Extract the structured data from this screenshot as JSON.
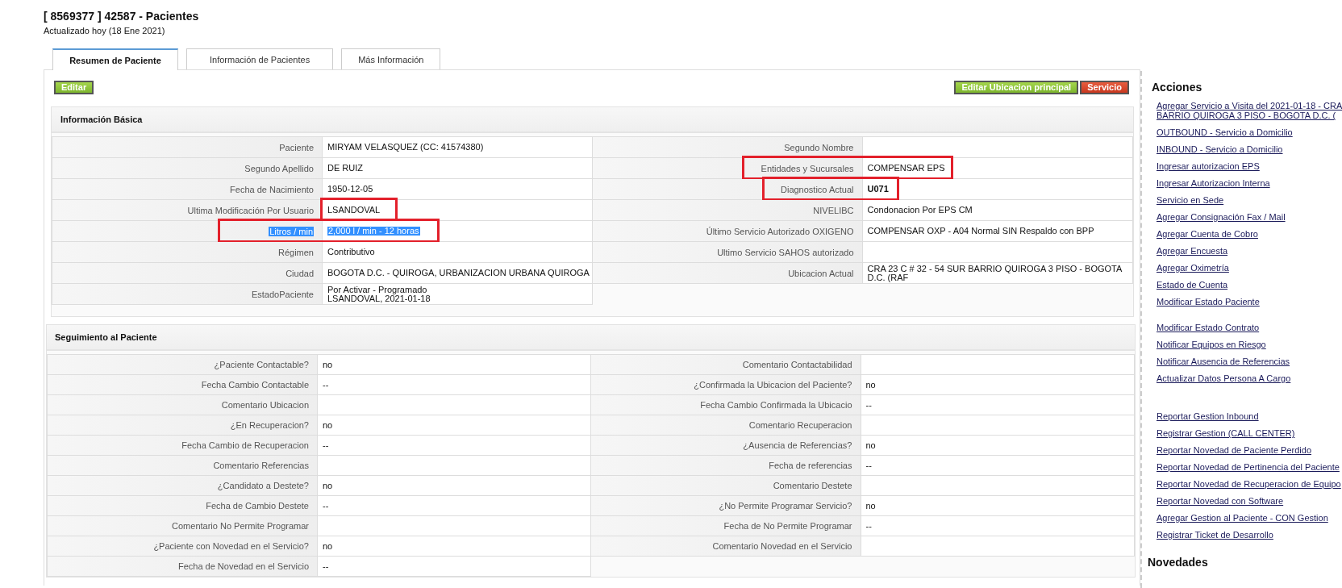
{
  "header": {
    "title": "[ 8569377 ] 42587 - Pacientes",
    "updated": "Actualizado hoy (18 Ene 2021)"
  },
  "tabs": [
    {
      "label": "Resumen de Paciente",
      "selected": true
    },
    {
      "label": "Información de Pacientes",
      "selected": false
    },
    {
      "label": "Más Información",
      "selected": false
    }
  ],
  "toolbar": {
    "left_buttons": [
      {
        "label": "Editar",
        "kind": "green"
      }
    ],
    "right_buttons": [
      {
        "label": "Editar Ubicacion principal",
        "kind": "green"
      },
      {
        "label": "Servicio",
        "kind": "red"
      }
    ]
  },
  "basic_info": {
    "title": "Información Básica",
    "left": [
      {
        "label": "Paciente",
        "value": "MIRYAM VELASQUEZ (CC: 41574380)"
      },
      {
        "label": "Segundo Apellido",
        "value": "DE RUIZ"
      },
      {
        "label": "Fecha de Nacimiento",
        "value": "1950-12-05"
      },
      {
        "label": "Ultima Modificación Por Usuario",
        "value": "LSANDOVAL",
        "annotated": true,
        "annotation_covers_label": false
      },
      {
        "label": "Litros / min",
        "value": "2,000 l / min - 12 horas",
        "annotated": true,
        "annotation_covers_label": true,
        "text_selected": true
      },
      {
        "label": "Régimen",
        "value": "Contributivo"
      },
      {
        "label": "Ciudad",
        "value": "BOGOTA D.C. - QUIROGA, URBANIZACION URBANA QUIROGA"
      },
      {
        "label": "EstadoPaciente",
        "value": "Por Activar - Programado\nLSANDOVAL, 2021-01-18"
      }
    ],
    "right": [
      {
        "label": "Segundo Nombre"
      },
      {
        "label": "Entidades y Sucursales",
        "value": "COMPENSAR EPS",
        "annotated": true,
        "annotation_covers_label": true
      },
      {
        "label": "Diagnostico Actual",
        "value": "U071",
        "annotated": true,
        "annotation_covers_label": true,
        "bold": true
      },
      {
        "label": "NIVELIBC",
        "value": "Condonacion Por EPS CM"
      },
      {
        "label": "Último Servicio Autorizado OXIGENO",
        "value": "COMPENSAR OXP - A04 Normal SIN Respaldo con BPP"
      },
      {
        "label": "Ultimo Servicio SAHOS autorizado"
      },
      {
        "label": "Ubicacion Actual",
        "value": "CRA 23 C # 32 - 54 SUR BARRIO QUIROGA 3 PISO - BOGOTA D.C. (RAF"
      }
    ]
  },
  "follow_up": {
    "title": "Seguimiento al Paciente",
    "left": [
      {
        "label": "¿Paciente Contactable?",
        "value": "no"
      },
      {
        "label": "Fecha Cambio Contactable",
        "value": "--"
      },
      {
        "label": "Comentario Ubicacion"
      },
      {
        "label": "¿En Recuperacion?",
        "value": "no"
      },
      {
        "label": "Fecha Cambio de Recuperacion",
        "value": "--"
      },
      {
        "label": "Comentario Referencias"
      },
      {
        "label": "¿Candidato a Destete?",
        "value": "no"
      },
      {
        "label": "Fecha de Cambio Destete",
        "value": "--"
      },
      {
        "label": "Comentario No Permite Programar"
      },
      {
        "label": "¿Paciente con Novedad en el Servicio?",
        "value": "no"
      },
      {
        "label": "Fecha de Novedad en el Servicio",
        "value": "--"
      }
    ],
    "right": [
      {
        "label": "Comentario Contactabilidad"
      },
      {
        "label": "¿Confirmada la Ubicacion del Paciente?",
        "value": "no"
      },
      {
        "label": "Fecha Cambio Confirmada la Ubicacio",
        "value": "--"
      },
      {
        "label": "Comentario Recuperacion"
      },
      {
        "label": "¿Ausencia de Referencias?",
        "value": "no"
      },
      {
        "label": "Fecha de referencias",
        "value": "--"
      },
      {
        "label": "Comentario Destete"
      },
      {
        "label": "¿No Permite Programar Servicio?",
        "value": "no"
      },
      {
        "label": "Fecha de No Permite Programar",
        "value": "--"
      },
      {
        "label": "Comentario Novedad en el Servicio"
      }
    ]
  },
  "sidebar": {
    "title": "Acciones",
    "groups": [
      [
        "Agregar Servicio a Visita del 2021-01-18 - CRA\nBARRIO QUIROGA 3 PISO - BOGOTA D.C. (",
        "OUTBOUND - Servicio a Domicilio",
        "INBOUND - Servicio a Domicilio",
        "Ingresar autorizacion EPS",
        "Ingresar Autorizacion Interna",
        "Servicio en Sede",
        "Agregar Consignación Fax / Mail",
        "Agregar Cuenta de Cobro",
        "Agregar Encuesta",
        "Agregar Oximetría",
        "Estado de Cuenta",
        "Modificar Estado Paciente"
      ],
      [
        "Modificar Estado Contrato",
        "Notificar Equipos en Riesgo",
        "Notificar Ausencia de Referencias",
        "Actualizar Datos Persona A Cargo"
      ],
      [
        "Reportar Gestion Inbound",
        "Registrar Gestion (CALL CENTER)",
        "Reportar Novedad de Paciente Perdido",
        "Reportar Novedad de Pertinencia del Paciente",
        "Reportar Novedad de Recuperacion de Equipo",
        "Reportar Novedad con Software",
        "Agregar Gestion al Paciente - CON Gestion",
        "Registrar Ticket de Desarrollo"
      ]
    ],
    "second_title": "Novedades"
  }
}
